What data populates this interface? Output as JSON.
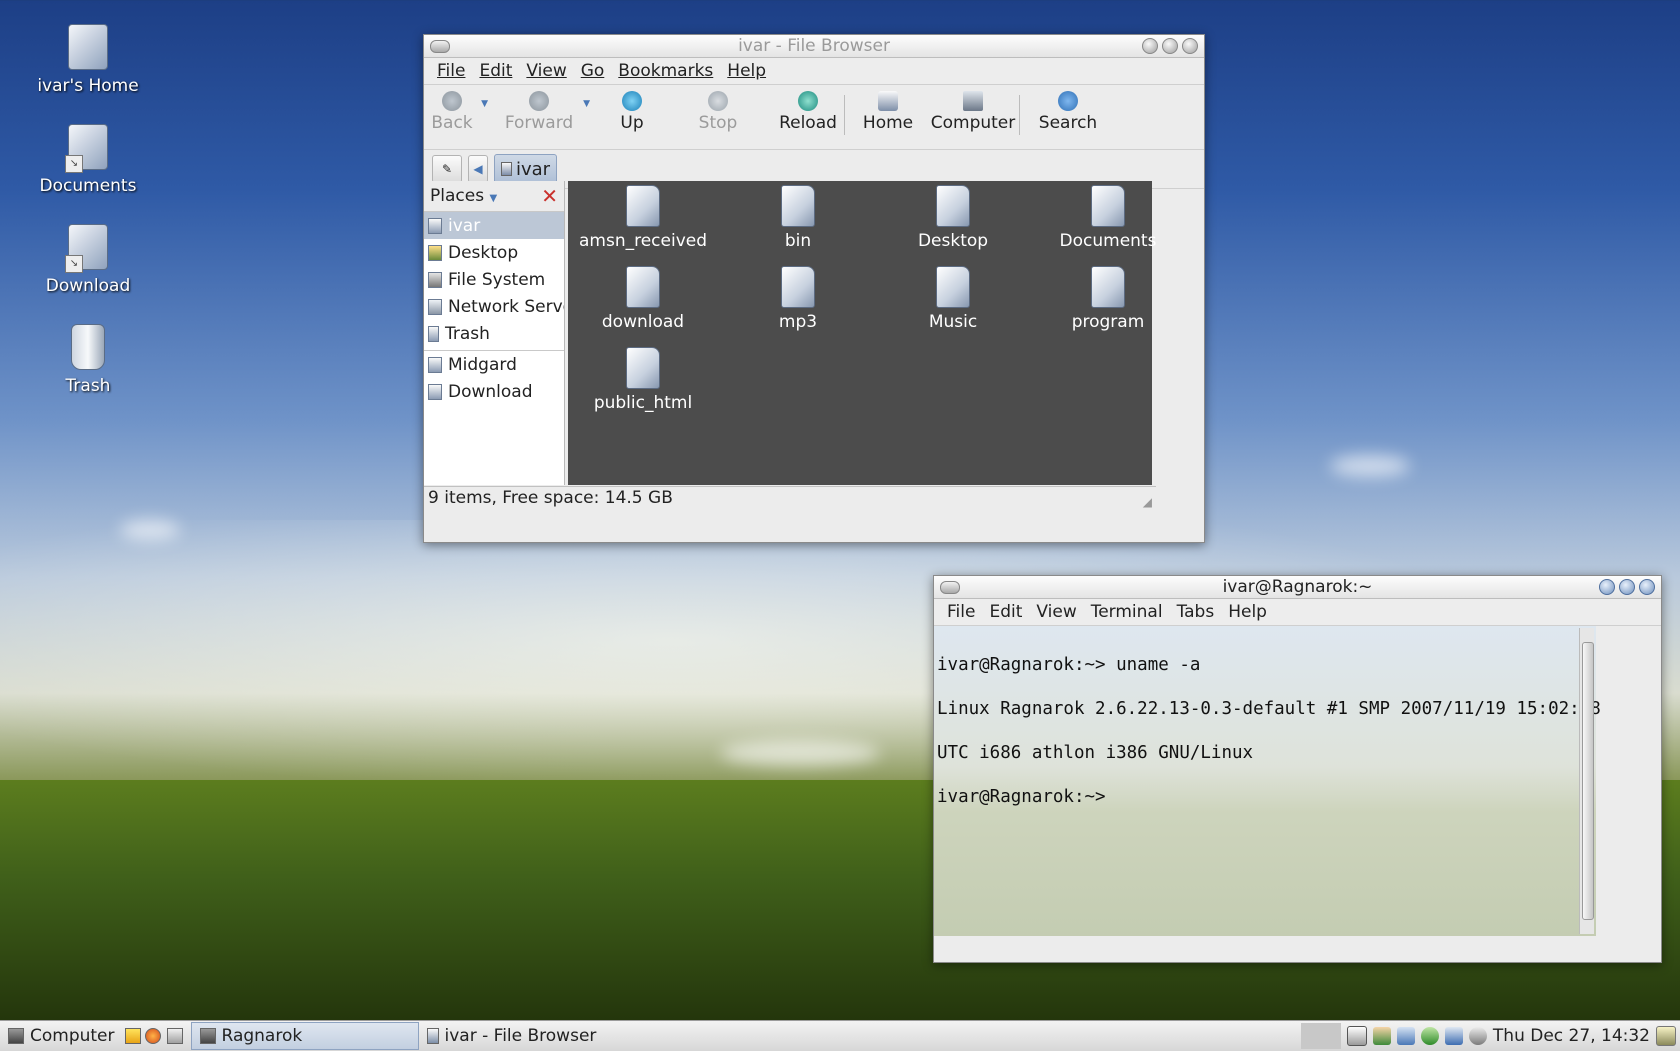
{
  "desktop": {
    "icons": [
      {
        "label": "ivar's Home"
      },
      {
        "label": "Documents"
      },
      {
        "label": "Download"
      },
      {
        "label": "Trash"
      }
    ]
  },
  "file_browser": {
    "title": "ivar - File Browser",
    "menu": [
      "File",
      "Edit",
      "View",
      "Go",
      "Bookmarks",
      "Help"
    ],
    "toolbar": {
      "back": "Back",
      "forward": "Forward",
      "up": "Up",
      "stop": "Stop",
      "reload": "Reload",
      "home": "Home",
      "computer": "Computer",
      "search": "Search"
    },
    "location": {
      "crumb": "ivar"
    },
    "places": {
      "header": "Places",
      "items": [
        "ivar",
        "Desktop",
        "File System",
        "Network Servers",
        "Trash"
      ],
      "bookmarks": [
        "Midgard",
        "Download"
      ]
    },
    "files": [
      "amsn_received",
      "bin",
      "Desktop",
      "Documents",
      "download",
      "mp3",
      "Music",
      "program",
      "public_html"
    ],
    "status": "9 items, Free space: 14.5 GB"
  },
  "terminal": {
    "title": "ivar@Ragnarok:~",
    "menu": [
      "File",
      "Edit",
      "View",
      "Terminal",
      "Tabs",
      "Help"
    ],
    "lines": [
      "ivar@Ragnarok:~> uname -a",
      "Linux Ragnarok 2.6.22.13-0.3-default #1 SMP 2007/11/19 15:02:58",
      "UTC i686 athlon i386 GNU/Linux",
      "ivar@Ragnarok:~>"
    ]
  },
  "taskbar": {
    "computer": "Computer",
    "tasks": [
      "Ragnarok",
      "ivar - File Browser"
    ],
    "clock": "Thu Dec 27, 14:32"
  },
  "colors": {
    "accent": "#4a78b6",
    "selection": "#bcc7d6",
    "icon_view_bg": "#4c4c4c"
  }
}
